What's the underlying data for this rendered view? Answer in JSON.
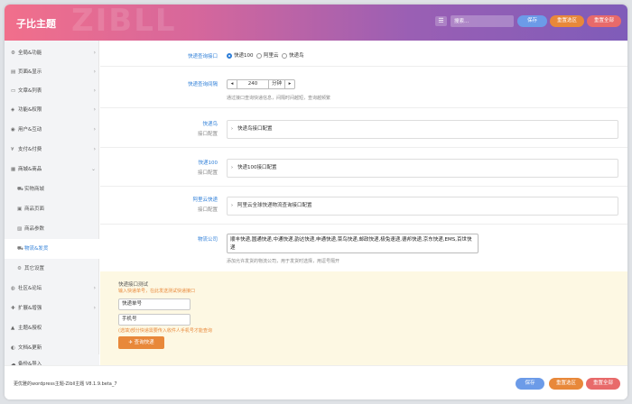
{
  "header": {
    "title": "子比主题",
    "watermark": "ZIBLL",
    "menu_icon": "list-icon",
    "search_placeholder": "搜索...",
    "save": "保存",
    "reset_section": "重置选区",
    "reset_all": "重置全部"
  },
  "colors": {
    "save": "#6c9be8",
    "reset_section": "#e8883a",
    "reset_all": "#e86a6a",
    "accent": "#2f7fd8"
  },
  "sidebar": {
    "items": [
      {
        "icon": "gear-icon",
        "glyph": "⚙",
        "label": "全局&功能",
        "chevron": "›"
      },
      {
        "icon": "layout-icon",
        "glyph": "▤",
        "label": "页面&显示",
        "chevron": "›"
      },
      {
        "icon": "document-icon",
        "glyph": "▭",
        "label": "文章&列表",
        "chevron": "›"
      },
      {
        "icon": "shield-icon",
        "glyph": "◈",
        "label": "功能&权限",
        "chevron": "›"
      },
      {
        "icon": "user-icon",
        "glyph": "◉",
        "label": "用户&互动",
        "chevron": "›"
      },
      {
        "icon": "yen-icon",
        "glyph": "¥",
        "label": "支付&付费",
        "chevron": "›"
      },
      {
        "icon": "shop-icon",
        "glyph": "▦",
        "label": "商城&商品",
        "chevron": "⌄"
      }
    ],
    "sub_items": [
      {
        "icon": "cart-icon",
        "glyph": "⛟",
        "label": "实物商城"
      },
      {
        "icon": "page-icon",
        "glyph": "▣",
        "label": "商品页面"
      },
      {
        "icon": "params-icon",
        "glyph": "▨",
        "label": "商品参数"
      },
      {
        "icon": "truck-icon",
        "glyph": "⛟",
        "label": "物流&发货"
      },
      {
        "icon": "settings-icon",
        "glyph": "⚙",
        "label": "其它设置"
      }
    ],
    "bottom_items": [
      {
        "icon": "community-icon",
        "glyph": "◍",
        "label": "社区&论坛",
        "chevron": "›"
      },
      {
        "icon": "plugin-icon",
        "glyph": "✚",
        "label": "扩展&增强",
        "chevron": "›"
      },
      {
        "icon": "theme-icon",
        "glyph": "▲",
        "label": "主题&授权",
        "chevron": ""
      },
      {
        "icon": "update-icon",
        "glyph": "◐",
        "label": "文档&更新",
        "chevron": ""
      },
      {
        "icon": "backup-icon",
        "glyph": "☁",
        "label": "备份&导入",
        "chevron": ""
      }
    ]
  },
  "main": {
    "query_api": {
      "label": "快递查询接口",
      "options": [
        "快递100",
        "阿里云",
        "快递鸟"
      ],
      "selected": "快递100"
    },
    "interval": {
      "label": "快递查询间隔",
      "value": "240",
      "unit": "分钟",
      "dec": "◂",
      "inc": "▸",
      "help": "通过接口查询快递信息，间隔时间越短，查询越频繁"
    },
    "kdniao": {
      "label": "快递鸟",
      "sub": "接口配置",
      "panel": "快递鸟接口配置",
      "arrow": "›"
    },
    "kd100": {
      "label": "快递100",
      "sub": "接口配置",
      "panel": "快递100接口配置",
      "arrow": "›"
    },
    "aliyun": {
      "label": "阿里云快递",
      "sub": "接口配置",
      "panel": "阿里云全球快递物流查询接口配置",
      "arrow": "›"
    },
    "companies": {
      "label": "物流公司",
      "value": "顺丰快递,圆通快递,中通快递,韵达快递,申通快递,菜鸟快递,邮政快递,极兔速递,德邦快递,京东快递,EMS,百世快递",
      "help": "添加允许发货的物流公司，用于发货时选择，用逗号隔开"
    },
    "test": {
      "title": "快递接口测试",
      "desc": "输入快递单号，在此发送测试快递接口",
      "number_placeholder": "快递单号",
      "phone_placeholder": "手机号",
      "note": "(选填)部分快递需要传入收件人手机号才能查询",
      "button": "查询快递",
      "button_icon": "send-icon"
    }
  },
  "footer": {
    "version": "更优雅的wordpress主题-Zibll主题 V8.1.9.beta_7",
    "save": "保存",
    "reset_section": "重置选区",
    "reset_all": "重置全部"
  }
}
